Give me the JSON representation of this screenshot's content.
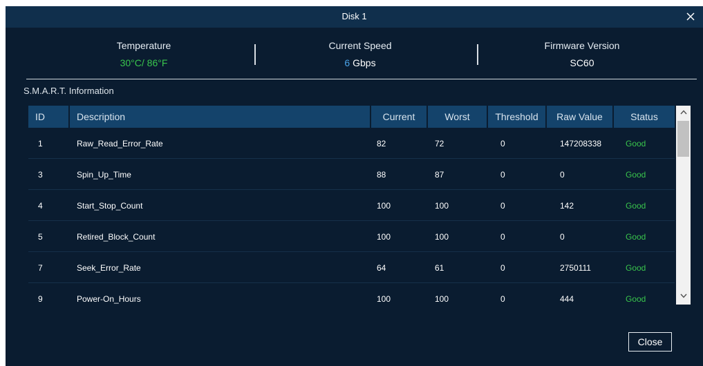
{
  "dialog": {
    "title": "Disk 1",
    "close_icon": "close-icon"
  },
  "info": {
    "temperature": {
      "label": "Temperature",
      "value": "30°C/ 86°F",
      "color": "#39c54c"
    },
    "speed": {
      "label": "Current Speed",
      "value_number": "6",
      "value_unit": " Gbps",
      "number_color": "#4aa3e8"
    },
    "firmware": {
      "label": "Firmware Version",
      "value": "SC60"
    }
  },
  "smart": {
    "section_title": "S.M.A.R.T. Information",
    "columns": [
      "ID",
      "Description",
      "Current",
      "Worst",
      "Threshold",
      "Raw Value",
      "Status"
    ],
    "rows": [
      {
        "id": "1",
        "description": "Raw_Read_Error_Rate",
        "current": "82",
        "worst": "72",
        "threshold": "0",
        "raw": "147208338",
        "status": "Good"
      },
      {
        "id": "3",
        "description": "Spin_Up_Time",
        "current": "88",
        "worst": "87",
        "threshold": "0",
        "raw": "0",
        "status": "Good"
      },
      {
        "id": "4",
        "description": "Start_Stop_Count",
        "current": "100",
        "worst": "100",
        "threshold": "0",
        "raw": "142",
        "status": "Good"
      },
      {
        "id": "5",
        "description": "Retired_Block_Count",
        "current": "100",
        "worst": "100",
        "threshold": "0",
        "raw": "0",
        "status": "Good"
      },
      {
        "id": "7",
        "description": "Seek_Error_Rate",
        "current": "64",
        "worst": "61",
        "threshold": "0",
        "raw": "2750111",
        "status": "Good"
      },
      {
        "id": "9",
        "description": "Power-On_Hours",
        "current": "100",
        "worst": "100",
        "threshold": "0",
        "raw": "444",
        "status": "Good"
      }
    ]
  },
  "footer": {
    "close_label": "Close"
  },
  "colors": {
    "title_bar": "#102f4c",
    "panel": "#0a1c30",
    "header": "#14436b",
    "good": "#39c54c"
  }
}
